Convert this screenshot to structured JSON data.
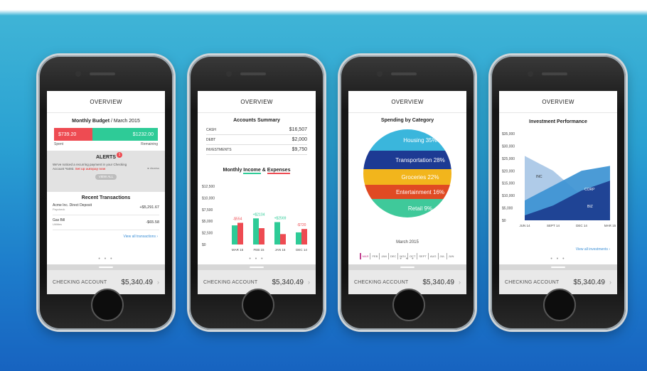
{
  "common": {
    "header": "OVERVIEW",
    "checking_label": "CHECKING ACCOUNT",
    "checking_amount": "$5,340.49",
    "chevron": "›",
    "dots": "• • •"
  },
  "screen1": {
    "budget_title": "Monthly Budget",
    "budget_month": "/ March 2015",
    "spent_value": "$739.20",
    "remaining_value": "$1232.00",
    "spent_label": "Spent",
    "remaining_label": "Remaining",
    "alerts_title": "ALERTS",
    "alerts_count": "1",
    "alert_message": "We've noticed a recurring payment in your Checking Account *6493.",
    "alert_link": "Set up autopay now",
    "alert_dismiss": "dismiss",
    "view_all": "VIEW ALL",
    "recent_title": "Recent Transactions",
    "transactions": [
      {
        "name": "Acme Inc. Direct Deposit",
        "sub": "Paycheck",
        "amount": "+$5,291.67"
      },
      {
        "name": "Gas Bill",
        "sub": "Utilities",
        "amount": "-$65.58"
      }
    ],
    "view_all_transactions": "View all transactions  ›"
  },
  "screen2": {
    "accounts_title": "Accounts Summary",
    "accounts": [
      {
        "name": "CASH",
        "value": "$16,507"
      },
      {
        "name": "DEBT",
        "value": "$2,000"
      },
      {
        "name": "INVESTMENTS",
        "value": "$9,750"
      }
    ],
    "chart_title_a": "Monthly",
    "chart_title_b": "Income",
    "chart_title_c": "&",
    "chart_title_d": "Expenses",
    "income_color": "#2ecb97",
    "expense_color": "#ee4b52",
    "y_ticks": [
      "$12,500",
      "$10,000",
      "$7,500",
      "$5,000",
      "$2,500",
      "$0"
    ],
    "net_labels": [
      "-$554",
      "+$2104",
      "+$2569",
      "-$720"
    ]
  },
  "screen3": {
    "title": "Spending by Category",
    "categories": [
      {
        "name": "Housing",
        "pct": "35%",
        "color": "#3ab6dc"
      },
      {
        "name": "Transportation",
        "pct": "28%",
        "color": "#1d3a93"
      },
      {
        "name": "Groceries",
        "pct": "22%",
        "color": "#f2b51c"
      },
      {
        "name": "Entertainment",
        "pct": "16%",
        "color": "#e04a23"
      },
      {
        "name": "Retail",
        "pct": "9%",
        "color": "#3fc99a"
      }
    ],
    "period": "March 2015",
    "months": [
      "MAR",
      "FEB",
      "JAN",
      "DEC",
      "NOV",
      "OCT",
      "SEPT",
      "AUG",
      "JUL",
      "JUN"
    ]
  },
  "screen4": {
    "title": "Investment Performance",
    "y_ticks": [
      "$35,000",
      "$30,000",
      "$25,000",
      "$20,000",
      "$15,000",
      "$10,000",
      "$5,000",
      "$0"
    ],
    "series_labels": [
      "INC",
      "CORP",
      "BIZ"
    ],
    "view_all_investments": "View all investments  ›"
  },
  "chart_data": [
    {
      "type": "bar",
      "title": "Monthly Income & Expenses",
      "categories": [
        "MAR 15",
        "FEB 15",
        "JAN 15",
        "DEC 14"
      ],
      "series": [
        {
          "name": "Income",
          "values": [
            4100,
            5600,
            4800,
            2600
          ]
        },
        {
          "name": "Expenses",
          "values": [
            4650,
            3500,
            2231,
            3320
          ]
        }
      ],
      "annotations": [
        "-$554",
        "+$2104",
        "+$2569",
        "-$720"
      ],
      "ylim": [
        0,
        12500
      ]
    },
    {
      "type": "pie",
      "title": "Spending by Category",
      "categories": [
        "Housing",
        "Transportation",
        "Groceries",
        "Entertainment",
        "Retail"
      ],
      "values": [
        35,
        28,
        22,
        16,
        9
      ]
    },
    {
      "type": "area",
      "title": "Investment Performance",
      "x": [
        "JUN 14",
        "SEPT 14",
        "DEC 14",
        "MAR 15"
      ],
      "series": [
        {
          "name": "INC",
          "values": [
            26000,
            20000,
            10000,
            3000
          ]
        },
        {
          "name": "CORP",
          "values": [
            8000,
            14000,
            20000,
            22000
          ]
        },
        {
          "name": "BIZ",
          "values": [
            2000,
            6000,
            12000,
            16000
          ]
        }
      ],
      "ylim": [
        0,
        35000
      ]
    }
  ]
}
